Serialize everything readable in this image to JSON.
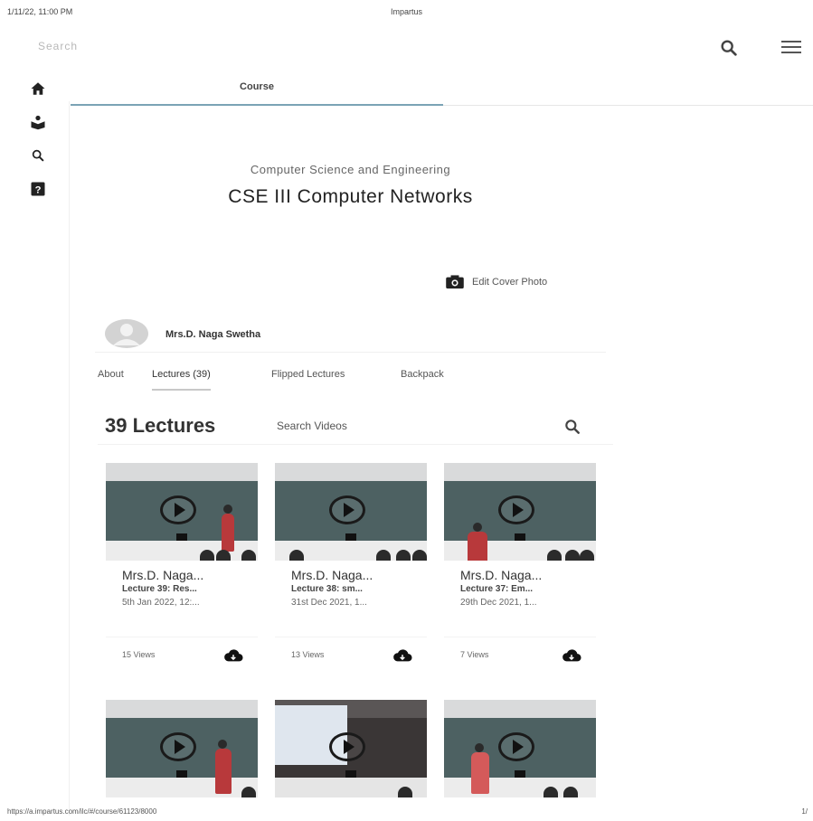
{
  "print": {
    "timestamp": "1/11/22, 11:00 PM",
    "title": "Impartus",
    "url": "https://a.impartus.com/ilc/#/course/61123/8000",
    "page": "1/"
  },
  "search": {
    "placeholder": "Search"
  },
  "icons": {
    "home": "home-icon",
    "classroom": "classroom-icon",
    "search": "search-icon",
    "help": "help-icon",
    "menu": "menu-icon",
    "camera": "camera-icon",
    "download": "cloud-download-icon",
    "play": "play-icon"
  },
  "course_tab": {
    "label": "Course"
  },
  "course": {
    "department": "Computer Science and Engineering",
    "title": "CSE III Computer Networks",
    "edit_cover": "Edit Cover Photo"
  },
  "instructor": {
    "name": "Mrs.D. Naga Swetha"
  },
  "profile_tabs": [
    {
      "label": "About"
    },
    {
      "label": "Lectures (39)"
    },
    {
      "label": "Flipped Lectures"
    },
    {
      "label": "Backpack"
    }
  ],
  "lectures": {
    "count_label": "39 Lectures",
    "search_placeholder": "Search Videos",
    "items": [
      {
        "name": "Mrs.D. Naga...",
        "lecture": "Lecture 39: Res...",
        "date": "5th Jan 2022, 12:...",
        "views": "15 Views"
      },
      {
        "name": "Mrs.D. Naga...",
        "lecture": "Lecture 38: sm...",
        "date": "31st Dec 2021, 1...",
        "views": "13 Views"
      },
      {
        "name": "Mrs.D. Naga...",
        "lecture": "Lecture 37: Em...",
        "date": "29th Dec 2021, 1...",
        "views": "7 Views"
      }
    ]
  },
  "colors": {
    "active_tab_underline": "#7ba3b5",
    "blackboard": "#4d6162",
    "presenter": "#b8393b"
  }
}
